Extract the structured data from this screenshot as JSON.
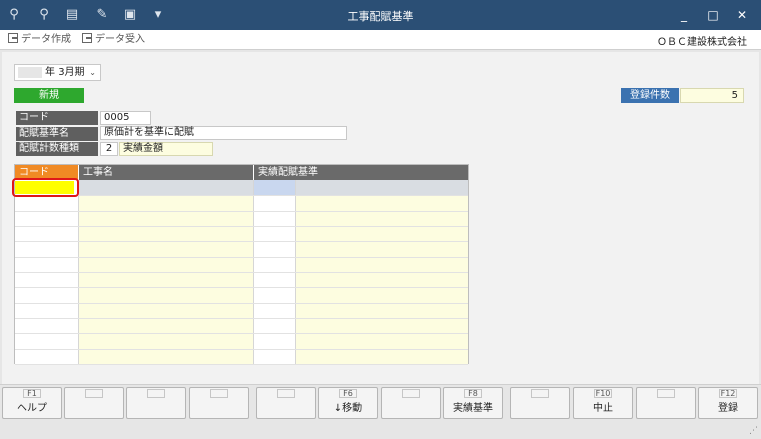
{
  "window": {
    "title": "工事配賦基準",
    "controls": [
      "_",
      "□",
      "✕"
    ]
  },
  "toolbar": {
    "export_label": "データ作成",
    "import_label": "データ受入",
    "company": "ＯＢＣ建設株式会社"
  },
  "period": {
    "year_suffix": "年",
    "term": "3月期"
  },
  "mode_badge": "新規",
  "record_count": {
    "label": "登録件数",
    "value": "5"
  },
  "form": {
    "code_label": "コード",
    "code_value": "0005",
    "name_label": "配賦基準名",
    "name_value": "原価計を基準に配賦",
    "type_label": "配賦計数種類",
    "type_code": "2",
    "type_name": "実績金額"
  },
  "grid": {
    "headers": [
      "コード",
      "工事名",
      "実績配賦基準"
    ],
    "header_colors": {
      "active": "#f08a24",
      "normal": "#6a6a6a"
    },
    "row_count": 12
  },
  "fkeys": [
    {
      "key": "F1",
      "label": "ヘルプ"
    },
    {
      "key": "",
      "label": ""
    },
    {
      "key": "",
      "label": ""
    },
    {
      "key": "",
      "label": ""
    },
    {
      "key": "",
      "label": ""
    },
    {
      "key": "F6",
      "label": "↓移動"
    },
    {
      "key": "",
      "label": ""
    },
    {
      "key": "F8",
      "label": "実績基準"
    },
    {
      "key": "",
      "label": ""
    },
    {
      "key": "F10",
      "label": "中止"
    },
    {
      "key": "",
      "label": ""
    },
    {
      "key": "F12",
      "label": "登録"
    }
  ]
}
